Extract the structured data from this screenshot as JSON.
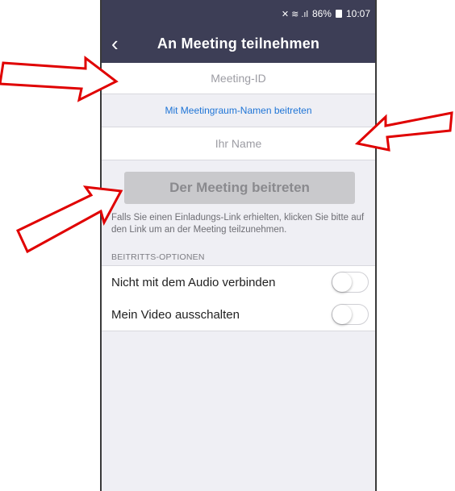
{
  "status_bar": {
    "signal_icons": "✕  ≋ .ıl",
    "battery_percent": "86%",
    "time": "10:07"
  },
  "nav": {
    "back_icon": "chevron-left",
    "title": "An Meeting teilnehmen"
  },
  "meeting_id": {
    "placeholder": "Meeting-ID"
  },
  "room_name_link": "Mit Meetingraum-Namen beitreten",
  "your_name": {
    "placeholder": "Ihr Name"
  },
  "join_button": "Der Meeting beitreten",
  "info_text": "Falls Sie einen Einladungs-Link erhielten, klicken Sie bitte auf den Link um an der Meeting teilzunehmen.",
  "options": {
    "header": "BEITRITTS-OPTIONEN",
    "items": [
      {
        "label": "Nicht mit dem Audio verbinden",
        "enabled": false
      },
      {
        "label": "Mein Video ausschalten",
        "enabled": false
      }
    ]
  },
  "colors": {
    "header_bg": "#3d3e56",
    "link": "#1e74d6",
    "annotation_arrow": "#e00000"
  }
}
